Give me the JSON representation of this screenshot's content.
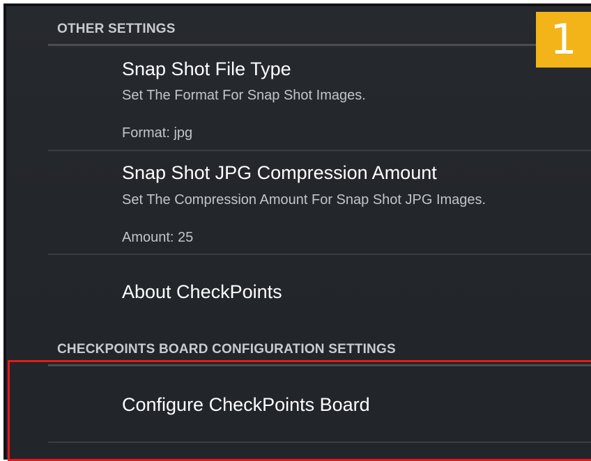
{
  "badge": {
    "label": "1",
    "color": "#f2b418"
  },
  "sections": [
    {
      "header": "OTHER SETTINGS",
      "items": [
        {
          "title": "Snap Shot File Type",
          "summary": "Set The Format For Snap Shot Images.",
          "value": "Format: jpg"
        },
        {
          "title": "Snap Shot JPG Compression Amount",
          "summary": "Set The Compression Amount For Snap Shot JPG Images.",
          "value": "Amount: 25"
        },
        {
          "title": "About CheckPoints"
        }
      ]
    },
    {
      "header": "CHECKPOINTS BOARD CONFIGURATION SETTINGS",
      "items": [
        {
          "title": "Configure CheckPoints Board"
        }
      ]
    }
  ],
  "highlight": {
    "color": "#e11b1b"
  }
}
